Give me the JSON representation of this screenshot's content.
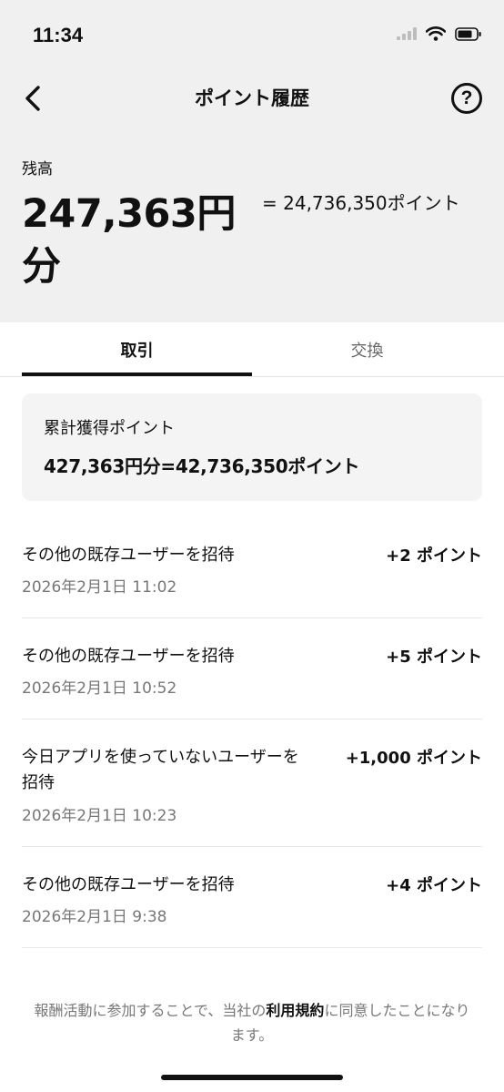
{
  "status_bar": {
    "time": "11:34"
  },
  "nav": {
    "title": "ポイント履歴",
    "help_symbol": "?"
  },
  "balance": {
    "label": "残高",
    "amount": "247,363円分",
    "points": "= 24,736,350ポイント"
  },
  "tabs": [
    {
      "label": "取引",
      "active": true
    },
    {
      "label": "交換",
      "active": false
    }
  ],
  "summary": {
    "label": "累計獲得ポイント",
    "value": "427,363円分=42,736,350ポイント"
  },
  "transactions": [
    {
      "description": "その他の既存ユーザーを招待",
      "date": "2026年2月1日 11:02",
      "amount": "+2 ポイント"
    },
    {
      "description": "その他の既存ユーザーを招待",
      "date": "2026年2月1日 10:52",
      "amount": "+5 ポイント"
    },
    {
      "description": "今日アプリを使っていないユーザーを招待",
      "date": "2026年2月1日 10:23",
      "amount": "+1,000 ポイント"
    },
    {
      "description": "その他の既存ユーザーを招待",
      "date": "2026年2月1日 9:38",
      "amount": "+4 ポイント"
    }
  ],
  "footer": {
    "text_before": "報酬活動に参加することで、当社の",
    "link": "利用規約",
    "text_after": "に同意したことになります。"
  },
  "colors": {
    "header_bg": "#f0f0f0",
    "card_bg": "#f4f4f4",
    "muted_text": "#777777",
    "primary_text": "#111111"
  }
}
